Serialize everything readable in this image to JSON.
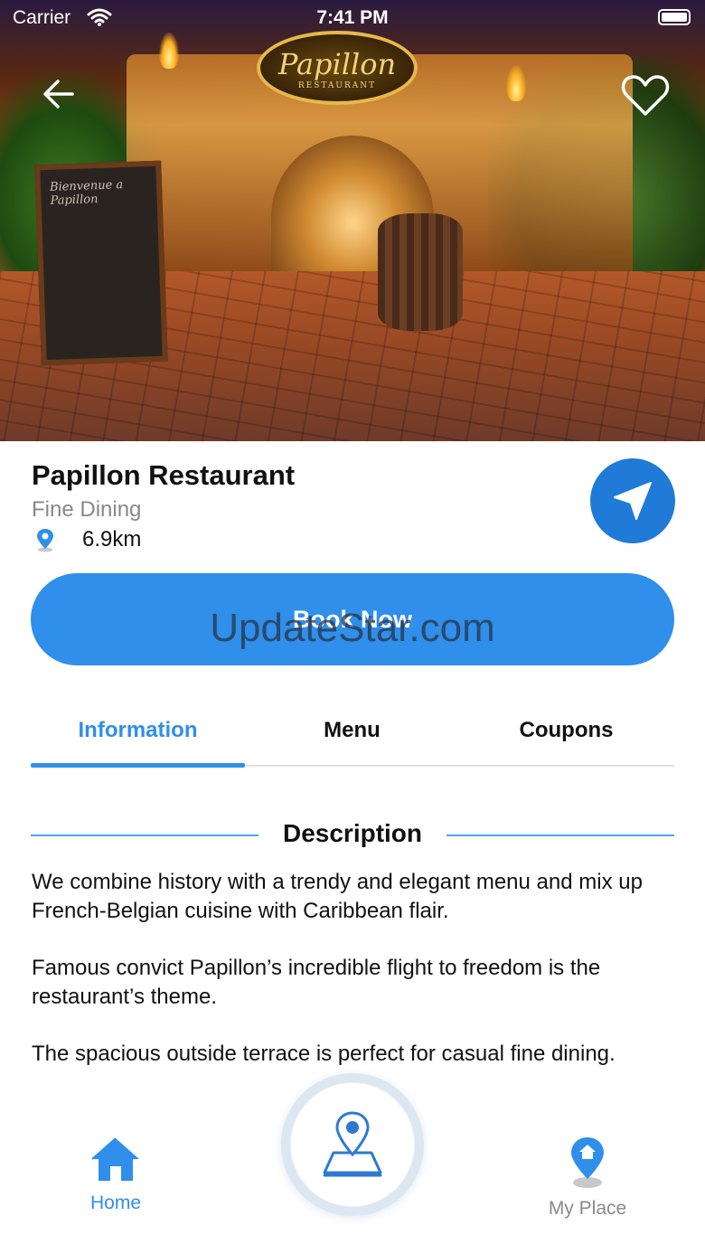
{
  "status_bar": {
    "carrier": "Carrier",
    "time": "7:41 PM"
  },
  "hero": {
    "sign_title": "Papillon",
    "sign_subtitle": "RESTAURANT",
    "chalkboard_text": "Bienvenue a Papillon"
  },
  "restaurant": {
    "name": "Papillon Restaurant",
    "category": "Fine Dining",
    "distance": "6.9km"
  },
  "actions": {
    "book_label": "Book Now"
  },
  "watermark": "UpdateStar.com",
  "tabs": [
    {
      "label": "Information",
      "active": true
    },
    {
      "label": "Menu",
      "active": false
    },
    {
      "label": "Coupons",
      "active": false
    }
  ],
  "description": {
    "heading": "Description",
    "paragraphs": [
      "We combine history with a trendy and elegant menu and mix up French-Belgian cuisine with Caribbean flair.",
      "Famous convict Papillon’s incredible flight to freedom is the restaurant’s theme.",
      "The spacious outside terrace is perfect for casual fine dining."
    ]
  },
  "bottom_nav": {
    "home_label": "Home",
    "place_label": "My Place"
  },
  "colors": {
    "accent": "#2f8fea",
    "nav_button": "#1f7ad8",
    "muted": "#888888"
  },
  "icons": [
    "back-arrow-icon",
    "heart-icon",
    "location-pin-icon",
    "navigation-arrow-icon",
    "home-icon",
    "map-pin-icon",
    "my-place-icon",
    "wifi-icon",
    "battery-icon"
  ]
}
